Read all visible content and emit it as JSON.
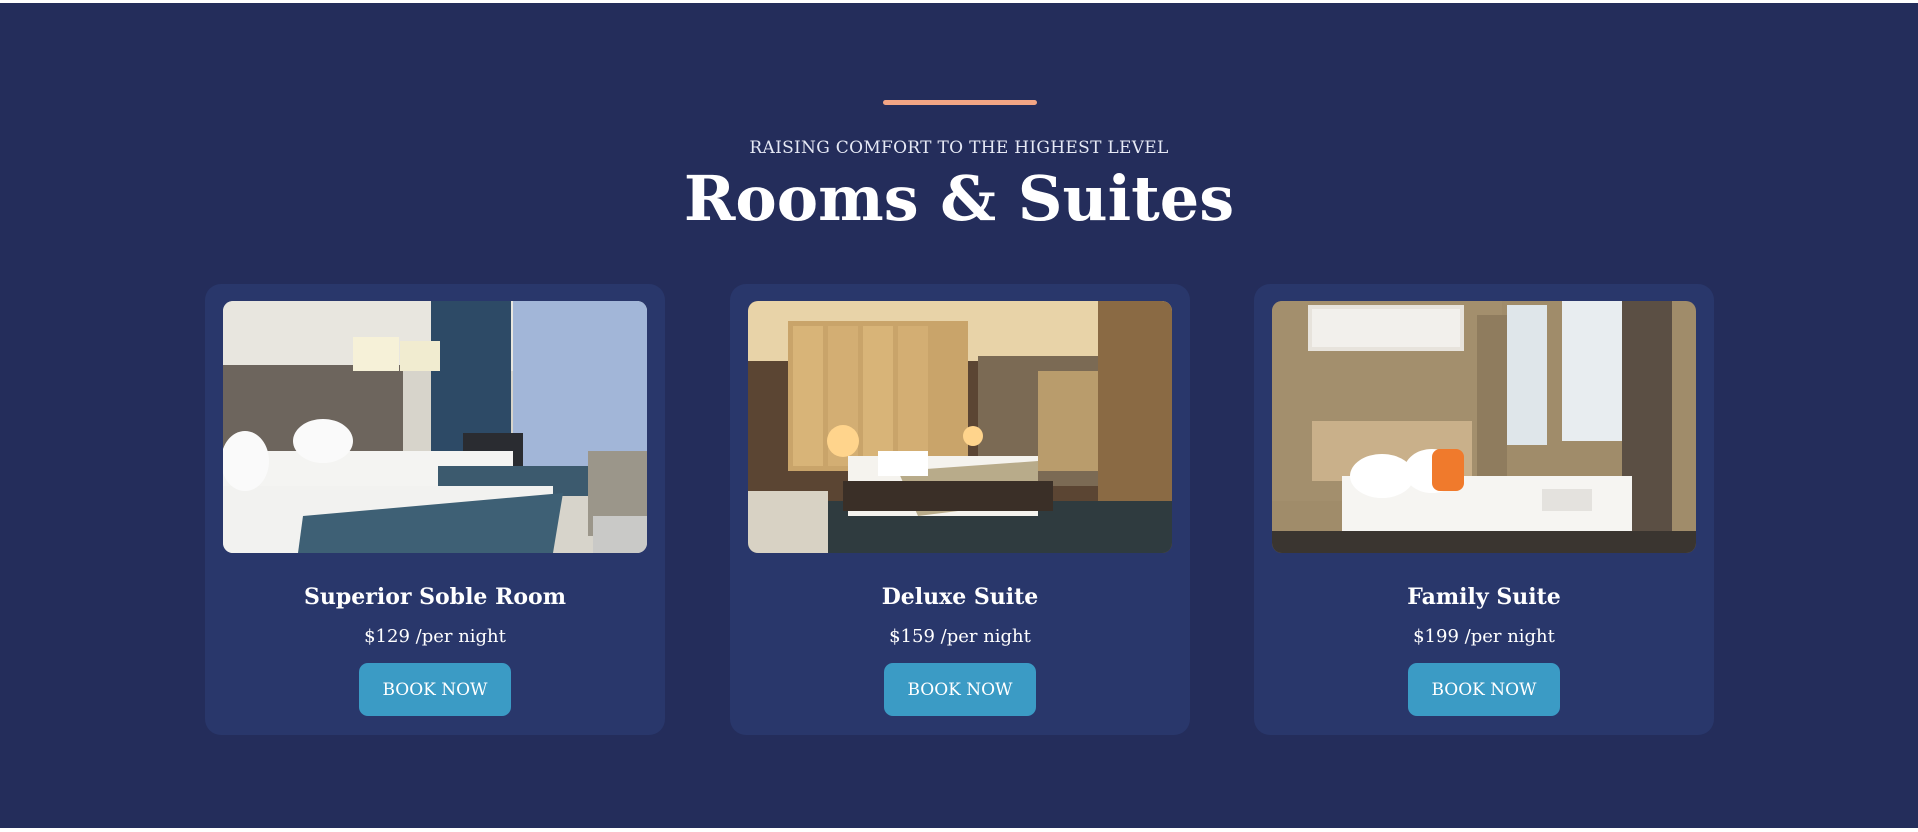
{
  "header": {
    "kicker": "RAISING COMFORT TO THE HIGHEST LEVEL",
    "title": "Rooms & Suites"
  },
  "colors": {
    "background": "#242d5b",
    "card": "#29376b",
    "accent_line": "#f2a585",
    "button": "#3b9bc5"
  },
  "rooms": [
    {
      "name": "Superior Soble Room",
      "price": "$129 /per night",
      "button_label": "BOOK NOW"
    },
    {
      "name": "Deluxe Suite",
      "price": "$159 /per night",
      "button_label": "BOOK NOW"
    },
    {
      "name": "Family Suite",
      "price": "$199 /per night",
      "button_label": "BOOK NOW"
    }
  ]
}
